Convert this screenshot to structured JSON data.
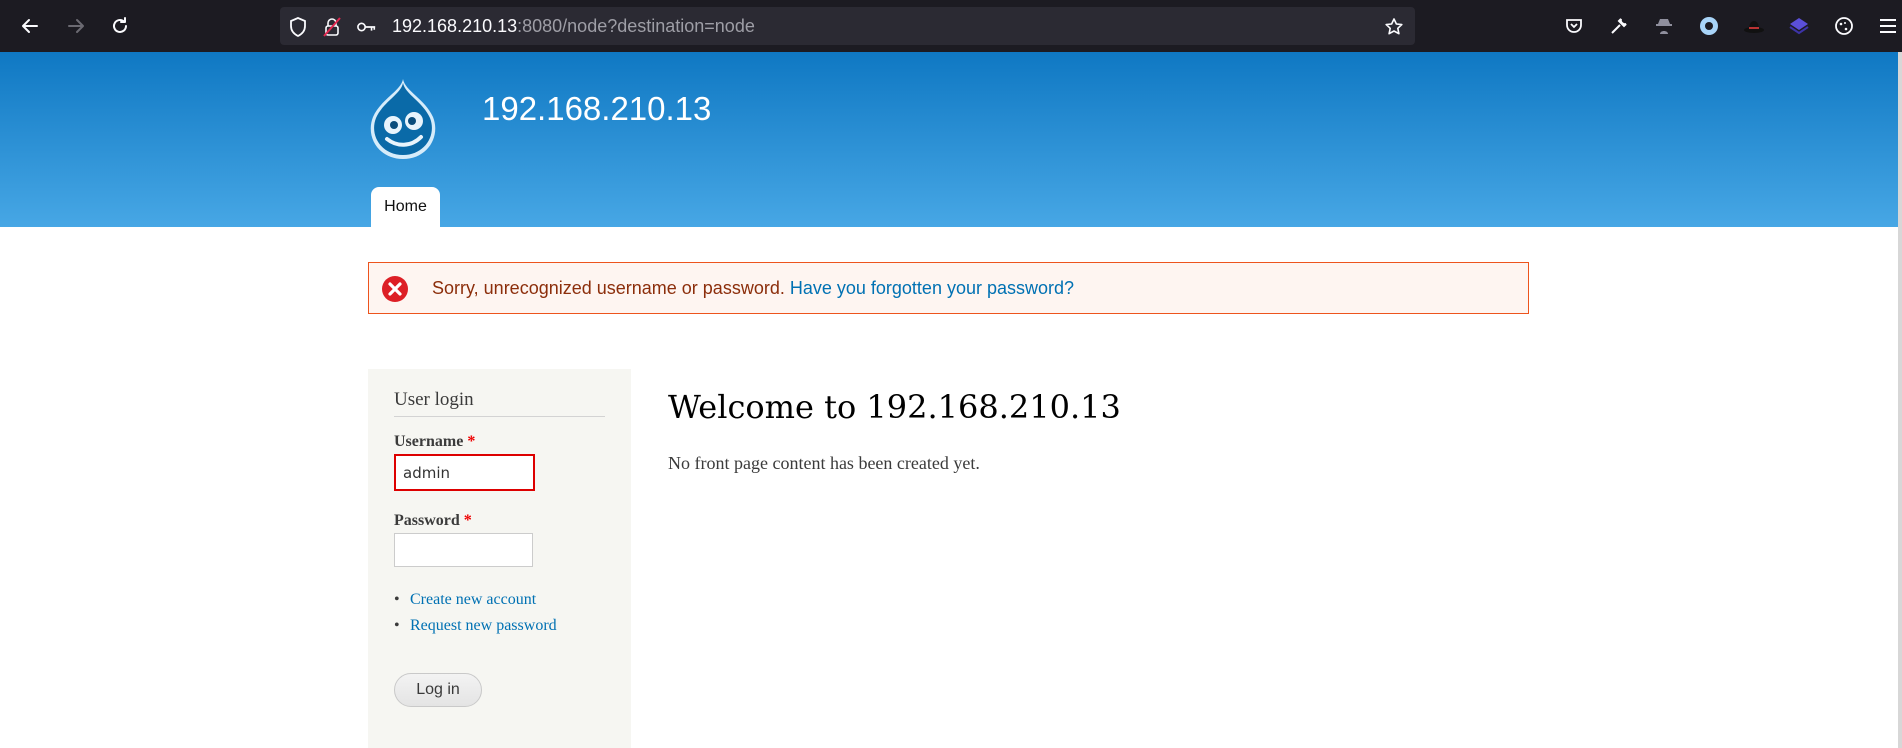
{
  "browser": {
    "url_host": "192.168.210.13",
    "url_rest": ":8080/node?destination=node"
  },
  "site": {
    "name": "192.168.210.13",
    "nav": {
      "home_label": "Home"
    }
  },
  "message": {
    "error_text": "Sorry, unrecognized username or password.",
    "link_text": "Have you forgotten your password?"
  },
  "login": {
    "title": "User login",
    "username_label": "Username",
    "password_label": "Password",
    "required_mark": "*",
    "username_value": "admin",
    "links": [
      "Create new account",
      "Request new password"
    ],
    "submit_label": "Log in"
  },
  "main": {
    "heading": "Welcome to 192.168.210.13",
    "body": "No front page content has been created yet."
  },
  "colors": {
    "header_top": "#0f78c3",
    "header_bottom": "#47a7e5",
    "link": "#0071b3",
    "error_border": "#ed541d",
    "error_bg": "#fef5f1",
    "error_text": "#8c2e0b"
  },
  "icons": [
    "back-arrow-icon",
    "forward-arrow-icon",
    "reload-icon",
    "shield-icon",
    "insecure-lock-icon",
    "key-icon",
    "bookmark-star-icon",
    "pocket-icon",
    "wrench-icon",
    "spy-icon",
    "circle-extension-icon",
    "hat-icon",
    "layers-icon",
    "cookie-icon",
    "menu-icon",
    "drupal-logo-icon",
    "error-x-icon"
  ]
}
